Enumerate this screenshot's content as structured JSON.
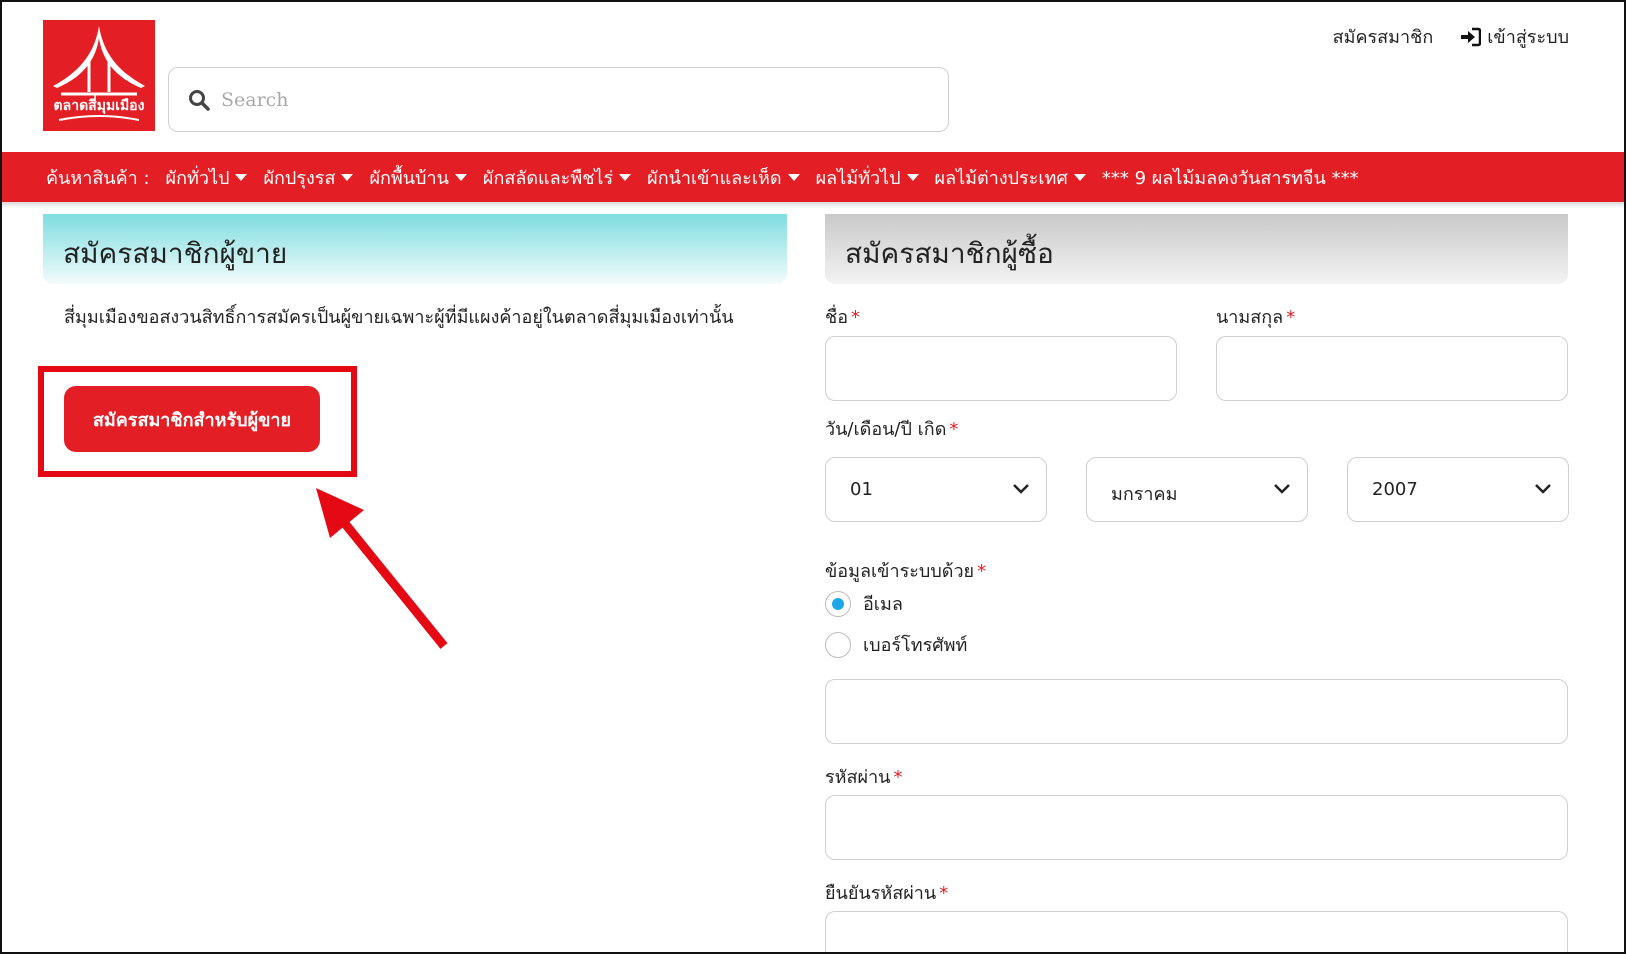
{
  "header": {
    "logo_text": "ตลาดสี่มุมเมือง",
    "search_placeholder": "Search",
    "register_link": "สมัครสมาชิก",
    "login_link": "เข้าสู่ระบบ"
  },
  "nav": {
    "label": "ค้นหาสินค้า :",
    "items": [
      "ผักทั่วไป",
      "ผักปรุงรส",
      "ผักพื้นบ้าน",
      "ผักสลัดและพืชไร่",
      "ผักนำเข้าและเห็ด",
      "ผลไม้ทั่วไป",
      "ผลไม้ต่างประเทศ"
    ],
    "promo": "*** 9 ผลไม้มลคงวันสารทจีน ***"
  },
  "seller": {
    "title": "สมัครสมาชิกผู้ขาย",
    "description": "สี่มุมเมืองขอสงวนสิทธิ์การสมัครเป็นผู้ขายเฉพาะผู้ที่มีแผงค้าอยู่ในตลาดสี่มุมเมืองเท่านั้น",
    "button": "สมัครสมาชิกสำหรับผู้ขาย"
  },
  "buyer": {
    "title": "สมัครสมาชิกผู้ซื้อ",
    "first_name_label": "ชื่อ",
    "last_name_label": "นามสกุล",
    "birthdate_label": "วัน/เดือน/ปี เกิด",
    "day": "01",
    "month": "มกราคม",
    "year": "2007",
    "login_with_label": "ข้อมูลเข้าระบบด้วย",
    "option_email": "อีเมล",
    "option_phone": "เบอร์โทรศัพท์",
    "password_label": "รหัสผ่าน",
    "confirm_password_label": "ยืนยันรหัสผ่าน",
    "required_mark": "*"
  },
  "colors": {
    "brand_red": "#e31e24",
    "radio_blue": "#1ea7e8",
    "annotation_red": "#e50914"
  }
}
